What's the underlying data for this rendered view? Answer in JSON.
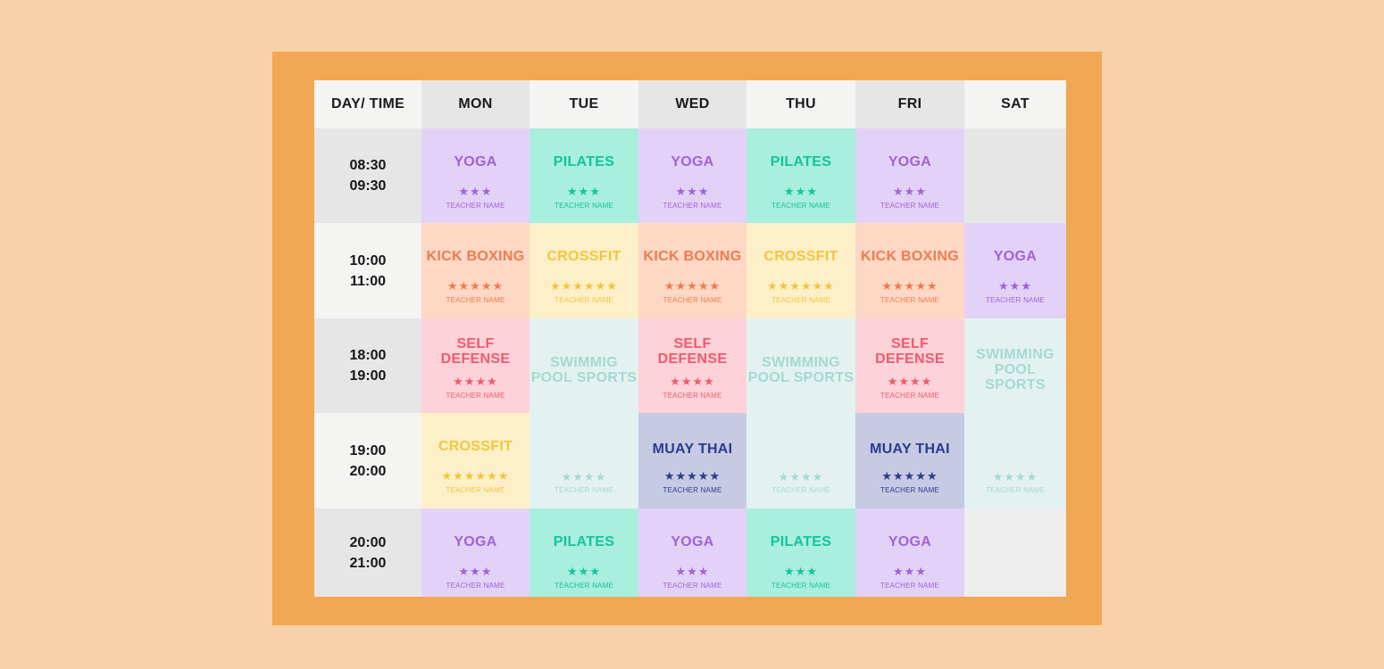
{
  "header": [
    "DAY/ TIME",
    "MON",
    "TUE",
    "WED",
    "THU",
    "FRI",
    "SAT"
  ],
  "rows": [
    {
      "time_start": "08:30",
      "time_end": "09:30",
      "cells": [
        {
          "name": "YOGA",
          "stars": "★★★",
          "teacher": "TEACHER NAME",
          "kind": "yoga"
        },
        {
          "name": "PILATES",
          "stars": "★★★",
          "teacher": "TEACHER NAME",
          "kind": "pilates"
        },
        {
          "name": "YOGA",
          "stars": "★★★",
          "teacher": "TEACHER NAME",
          "kind": "yoga"
        },
        {
          "name": "PILATES",
          "stars": "★★★",
          "teacher": "TEACHER NAME",
          "kind": "pilates"
        },
        {
          "name": "YOGA",
          "stars": "★★★",
          "teacher": "TEACHER NAME",
          "kind": "yoga"
        },
        {
          "name": "",
          "stars": "",
          "teacher": "",
          "kind": "empty-dark"
        }
      ]
    },
    {
      "time_start": "10:00",
      "time_end": "11:00",
      "cells": [
        {
          "name": "KICK BOXING",
          "stars": "★★★★★",
          "teacher": "TEACHER NAME",
          "kind": "kick"
        },
        {
          "name": "CROSSFIT",
          "stars": "★★★★★★",
          "teacher": "TEACHER NAME",
          "kind": "crossfit"
        },
        {
          "name": "KICK BOXING",
          "stars": "★★★★★",
          "teacher": "TEACHER NAME",
          "kind": "kick"
        },
        {
          "name": "CROSSFIT",
          "stars": "★★★★★★",
          "teacher": "TEACHER NAME",
          "kind": "crossfit"
        },
        {
          "name": "KICK BOXING",
          "stars": "★★★★★",
          "teacher": "TEACHER NAME",
          "kind": "kick"
        },
        {
          "name": "YOGA",
          "stars": "★★★",
          "teacher": "TEACHER NAME",
          "kind": "yoga"
        }
      ]
    },
    {
      "time_start": "18:00",
      "time_end": "19:00",
      "cells": [
        {
          "name": "SELF DEFENSE",
          "stars": "★★★★",
          "teacher": "TEACHER NAME",
          "kind": "self"
        },
        {
          "name": "SWIMMIG POOL SPORTS",
          "stars": "",
          "teacher": "",
          "kind": "swim"
        },
        {
          "name": "SELF DEFENSE",
          "stars": "★★★★",
          "teacher": "TEACHER NAME",
          "kind": "self"
        },
        {
          "name": "SWIMMING POOL SPORTS",
          "stars": "",
          "teacher": "",
          "kind": "swim"
        },
        {
          "name": "SELF DEFENSE",
          "stars": "★★★★",
          "teacher": "TEACHER NAME",
          "kind": "self"
        },
        {
          "name": "SWIMMING POOL SPORTS",
          "stars": "",
          "teacher": "",
          "kind": "swim"
        }
      ]
    },
    {
      "time_start": "19:00",
      "time_end": "20:00",
      "cells": [
        {
          "name": "CROSSFIT",
          "stars": "★★★★★★",
          "teacher": "TEACHER NAME",
          "kind": "crossfit"
        },
        {
          "name": "",
          "stars": "★★★★",
          "teacher": "TEACHER NAME",
          "kind": "swim"
        },
        {
          "name": "MUAY THAI",
          "stars": "★★★★★",
          "teacher": "TEACHER NAME",
          "kind": "muay"
        },
        {
          "name": "",
          "stars": "★★★★",
          "teacher": "TEACHER NAME",
          "kind": "swim"
        },
        {
          "name": "MUAY THAI",
          "stars": "★★★★★",
          "teacher": "TEACHER NAME",
          "kind": "muay"
        },
        {
          "name": "",
          "stars": "★★★★",
          "teacher": "TEACHER NAME",
          "kind": "swim"
        }
      ]
    },
    {
      "time_start": "20:00",
      "time_end": "21:00",
      "cells": [
        {
          "name": "YOGA",
          "stars": "★★★",
          "teacher": "TEACHER NAME",
          "kind": "yoga"
        },
        {
          "name": "PILATES",
          "stars": "★★★",
          "teacher": "TEACHER NAME",
          "kind": "pilates"
        },
        {
          "name": "YOGA",
          "stars": "★★★",
          "teacher": "TEACHER NAME",
          "kind": "yoga"
        },
        {
          "name": "PILATES",
          "stars": "★★★",
          "teacher": "TEACHER NAME",
          "kind": "pilates"
        },
        {
          "name": "YOGA",
          "stars": "★★★",
          "teacher": "TEACHER NAME",
          "kind": "yoga"
        },
        {
          "name": "",
          "stars": "",
          "teacher": "",
          "kind": "empty-light"
        }
      ]
    }
  ],
  "colors": {
    "background": "#f7d1a8",
    "frame": "#f2a752",
    "yoga": "#a062da",
    "pilates": "#12c59b",
    "kick_boxing": "#f17a4f",
    "crossfit": "#f2c53d",
    "self_defense": "#f05a6c",
    "swimming": "#a4d9d2",
    "muay_thai": "#2c3a8e"
  }
}
